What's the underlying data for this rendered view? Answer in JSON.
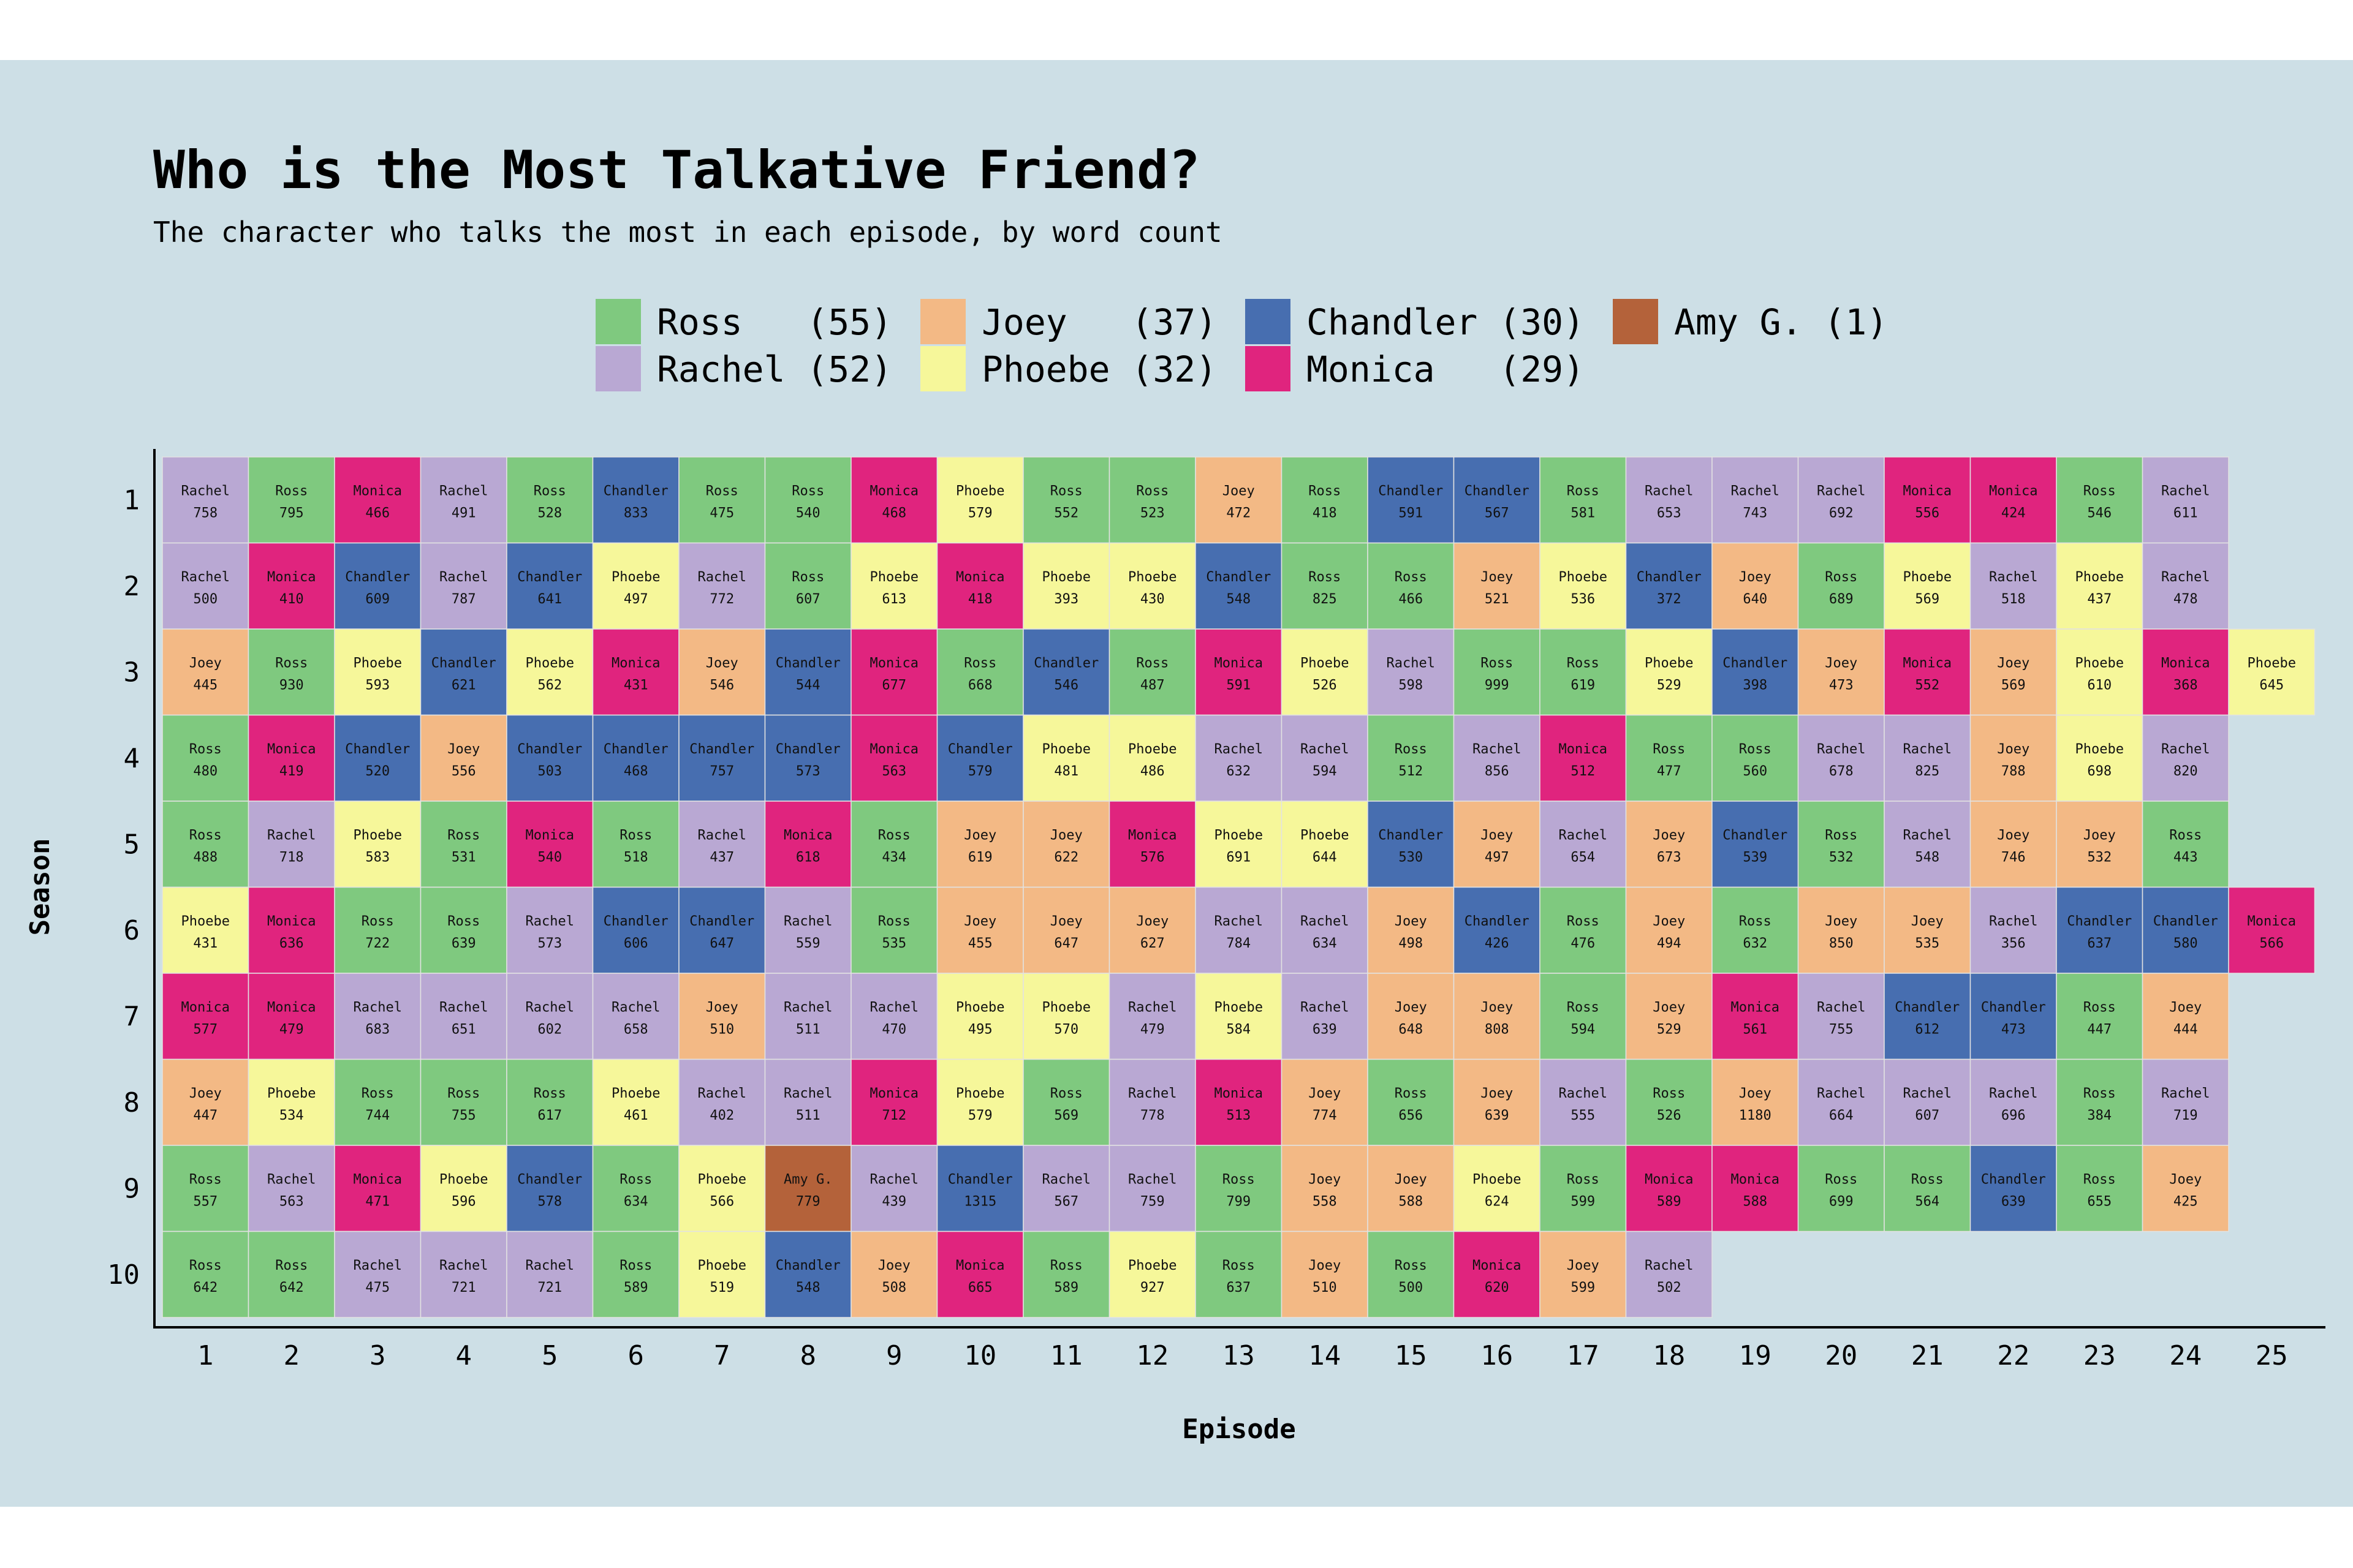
{
  "title": "Who is the Most Talkative Friend?",
  "subtitle": "The character who talks the most in each episode, by word count",
  "chart_data": {
    "type": "heatmap",
    "xlabel": "Episode",
    "ylabel": "Season",
    "x_ticks": [
      1,
      2,
      3,
      4,
      5,
      6,
      7,
      8,
      9,
      10,
      11,
      12,
      13,
      14,
      15,
      16,
      17,
      18,
      19,
      20,
      21,
      22,
      23,
      24,
      25
    ],
    "y_ticks": [
      1,
      2,
      3,
      4,
      5,
      6,
      7,
      8,
      9,
      10
    ],
    "legend": [
      {
        "name": "Ross",
        "count": "(55)",
        "color": "#7fc97f"
      },
      {
        "name": "Joey",
        "count": "(37)",
        "color": "#f3b985"
      },
      {
        "name": "Chandler",
        "count": "(30)",
        "color": "#476eb0"
      },
      {
        "name": "Amy G.",
        "count": "(1)",
        "color": "#b4623a"
      },
      {
        "name": "Rachel",
        "count": "(52)",
        "color": "#b9a8d3"
      },
      {
        "name": "Phoebe",
        "count": "(32)",
        "color": "#f6f79a"
      },
      {
        "name": "Monica",
        "count": "(29)",
        "color": "#e0247e"
      }
    ],
    "colors": {
      "Ross": "#7fc97f",
      "Rachel": "#b9a8d3",
      "Joey": "#f3b985",
      "Phoebe": "#f6f79a",
      "Chandler": "#476eb0",
      "Monica": "#e0247e",
      "Amy G.": "#b4623a"
    },
    "seasons": [
      [
        [
          "Rachel",
          758
        ],
        [
          "Ross",
          795
        ],
        [
          "Monica",
          466
        ],
        [
          "Rachel",
          491
        ],
        [
          "Ross",
          528
        ],
        [
          "Chandler",
          833
        ],
        [
          "Ross",
          475
        ],
        [
          "Ross",
          540
        ],
        [
          "Monica",
          468
        ],
        [
          "Phoebe",
          579
        ],
        [
          "Ross",
          552
        ],
        [
          "Ross",
          523
        ],
        [
          "Joey",
          472
        ],
        [
          "Ross",
          418
        ],
        [
          "Chandler",
          591
        ],
        [
          "Chandler",
          567
        ],
        [
          "Ross",
          581
        ],
        [
          "Rachel",
          653
        ],
        [
          "Rachel",
          743
        ],
        [
          "Rachel",
          692
        ],
        [
          "Monica",
          556
        ],
        [
          "Monica",
          424
        ],
        [
          "Ross",
          546
        ],
        [
          "Rachel",
          611
        ]
      ],
      [
        [
          "Rachel",
          500
        ],
        [
          "Monica",
          410
        ],
        [
          "Chandler",
          609
        ],
        [
          "Rachel",
          787
        ],
        [
          "Chandler",
          641
        ],
        [
          "Phoebe",
          497
        ],
        [
          "Rachel",
          772
        ],
        [
          "Ross",
          607
        ],
        [
          "Phoebe",
          613
        ],
        [
          "Monica",
          418
        ],
        [
          "Phoebe",
          393
        ],
        [
          "Phoebe",
          430
        ],
        [
          "Chandler",
          548
        ],
        [
          "Ross",
          825
        ],
        [
          "Ross",
          466
        ],
        [
          "Joey",
          521
        ],
        [
          "Phoebe",
          536
        ],
        [
          "Chandler",
          372
        ],
        [
          "Joey",
          640
        ],
        [
          "Ross",
          689
        ],
        [
          "Phoebe",
          569
        ],
        [
          "Rachel",
          518
        ],
        [
          "Phoebe",
          437
        ],
        [
          "Rachel",
          478
        ]
      ],
      [
        [
          "Joey",
          445
        ],
        [
          "Ross",
          930
        ],
        [
          "Phoebe",
          593
        ],
        [
          "Chandler",
          621
        ],
        [
          "Phoebe",
          562
        ],
        [
          "Monica",
          431
        ],
        [
          "Joey",
          546
        ],
        [
          "Chandler",
          544
        ],
        [
          "Monica",
          677
        ],
        [
          "Ross",
          668
        ],
        [
          "Chandler",
          546
        ],
        [
          "Ross",
          487
        ],
        [
          "Monica",
          591
        ],
        [
          "Phoebe",
          526
        ],
        [
          "Rachel",
          598
        ],
        [
          "Ross",
          999
        ],
        [
          "Ross",
          619
        ],
        [
          "Phoebe",
          529
        ],
        [
          "Chandler",
          398
        ],
        [
          "Joey",
          473
        ],
        [
          "Monica",
          552
        ],
        [
          "Joey",
          569
        ],
        [
          "Phoebe",
          610
        ],
        [
          "Monica",
          368
        ],
        [
          "Phoebe",
          645
        ]
      ],
      [
        [
          "Ross",
          480
        ],
        [
          "Monica",
          419
        ],
        [
          "Chandler",
          520
        ],
        [
          "Joey",
          556
        ],
        [
          "Chandler",
          503
        ],
        [
          "Chandler",
          468
        ],
        [
          "Chandler",
          757
        ],
        [
          "Chandler",
          573
        ],
        [
          "Monica",
          563
        ],
        [
          "Chandler",
          579
        ],
        [
          "Phoebe",
          481
        ],
        [
          "Phoebe",
          486
        ],
        [
          "Rachel",
          632
        ],
        [
          "Rachel",
          594
        ],
        [
          "Ross",
          512
        ],
        [
          "Rachel",
          856
        ],
        [
          "Monica",
          512
        ],
        [
          "Ross",
          477
        ],
        [
          "Ross",
          560
        ],
        [
          "Rachel",
          678
        ],
        [
          "Rachel",
          825
        ],
        [
          "Joey",
          788
        ],
        [
          "Phoebe",
          698
        ],
        [
          "Rachel",
          820
        ]
      ],
      [
        [
          "Ross",
          488
        ],
        [
          "Rachel",
          718
        ],
        [
          "Phoebe",
          583
        ],
        [
          "Ross",
          531
        ],
        [
          "Monica",
          540
        ],
        [
          "Ross",
          518
        ],
        [
          "Rachel",
          437
        ],
        [
          "Monica",
          618
        ],
        [
          "Ross",
          434
        ],
        [
          "Joey",
          619
        ],
        [
          "Joey",
          622
        ],
        [
          "Monica",
          576
        ],
        [
          "Phoebe",
          691
        ],
        [
          "Phoebe",
          644
        ],
        [
          "Chandler",
          530
        ],
        [
          "Joey",
          497
        ],
        [
          "Rachel",
          654
        ],
        [
          "Joey",
          673
        ],
        [
          "Chandler",
          539
        ],
        [
          "Ross",
          532
        ],
        [
          "Rachel",
          548
        ],
        [
          "Joey",
          746
        ],
        [
          "Joey",
          532
        ],
        [
          "Ross",
          443
        ]
      ],
      [
        [
          "Phoebe",
          431
        ],
        [
          "Monica",
          636
        ],
        [
          "Ross",
          722
        ],
        [
          "Ross",
          639
        ],
        [
          "Rachel",
          573
        ],
        [
          "Chandler",
          606
        ],
        [
          "Chandler",
          647
        ],
        [
          "Rachel",
          559
        ],
        [
          "Ross",
          535
        ],
        [
          "Joey",
          455
        ],
        [
          "Joey",
          647
        ],
        [
          "Joey",
          627
        ],
        [
          "Rachel",
          784
        ],
        [
          "Rachel",
          634
        ],
        [
          "Joey",
          498
        ],
        [
          "Chandler",
          426
        ],
        [
          "Ross",
          476
        ],
        [
          "Joey",
          494
        ],
        [
          "Ross",
          632
        ],
        [
          "Joey",
          850
        ],
        [
          "Joey",
          535
        ],
        [
          "Rachel",
          356
        ],
        [
          "Chandler",
          637
        ],
        [
          "Chandler",
          580
        ],
        [
          "Monica",
          566
        ]
      ],
      [
        [
          "Monica",
          577
        ],
        [
          "Monica",
          479
        ],
        [
          "Rachel",
          683
        ],
        [
          "Rachel",
          651
        ],
        [
          "Rachel",
          602
        ],
        [
          "Rachel",
          658
        ],
        [
          "Joey",
          510
        ],
        [
          "Rachel",
          511
        ],
        [
          "Rachel",
          470
        ],
        [
          "Phoebe",
          495
        ],
        [
          "Phoebe",
          570
        ],
        [
          "Rachel",
          479
        ],
        [
          "Phoebe",
          584
        ],
        [
          "Rachel",
          639
        ],
        [
          "Joey",
          648
        ],
        [
          "Joey",
          808
        ],
        [
          "Ross",
          594
        ],
        [
          "Joey",
          529
        ],
        [
          "Monica",
          561
        ],
        [
          "Rachel",
          755
        ],
        [
          "Chandler",
          612
        ],
        [
          "Chandler",
          473
        ],
        [
          "Ross",
          447
        ],
        [
          "Joey",
          444
        ]
      ],
      [
        [
          "Joey",
          447
        ],
        [
          "Phoebe",
          534
        ],
        [
          "Ross",
          744
        ],
        [
          "Ross",
          755
        ],
        [
          "Ross",
          617
        ],
        [
          "Phoebe",
          461
        ],
        [
          "Rachel",
          402
        ],
        [
          "Rachel",
          511
        ],
        [
          "Monica",
          712
        ],
        [
          "Phoebe",
          579
        ],
        [
          "Ross",
          569
        ],
        [
          "Rachel",
          778
        ],
        [
          "Monica",
          513
        ],
        [
          "Joey",
          774
        ],
        [
          "Ross",
          656
        ],
        [
          "Joey",
          639
        ],
        [
          "Rachel",
          555
        ],
        [
          "Ross",
          526
        ],
        [
          "Joey",
          1180
        ],
        [
          "Rachel",
          664
        ],
        [
          "Rachel",
          607
        ],
        [
          "Rachel",
          696
        ],
        [
          "Ross",
          384
        ],
        [
          "Rachel",
          719
        ]
      ],
      [
        [
          "Ross",
          557
        ],
        [
          "Rachel",
          563
        ],
        [
          "Monica",
          471
        ],
        [
          "Phoebe",
          596
        ],
        [
          "Chandler",
          578
        ],
        [
          "Ross",
          634
        ],
        [
          "Phoebe",
          566
        ],
        [
          "Amy G.",
          779
        ],
        [
          "Rachel",
          439
        ],
        [
          "Chandler",
          1315
        ],
        [
          "Rachel",
          567
        ],
        [
          "Rachel",
          759
        ],
        [
          "Ross",
          799
        ],
        [
          "Joey",
          558
        ],
        [
          "Joey",
          588
        ],
        [
          "Phoebe",
          624
        ],
        [
          "Ross",
          599
        ],
        [
          "Monica",
          589
        ],
        [
          "Monica",
          588
        ],
        [
          "Ross",
          699
        ],
        [
          "Ross",
          564
        ],
        [
          "Chandler",
          639
        ],
        [
          "Ross",
          655
        ],
        [
          "Joey",
          425
        ]
      ],
      [
        [
          "Ross",
          642
        ],
        [
          "Ross",
          642
        ],
        [
          "Rachel",
          475
        ],
        [
          "Rachel",
          721
        ],
        [
          "Rachel",
          721
        ],
        [
          "Ross",
          589
        ],
        [
          "Phoebe",
          519
        ],
        [
          "Chandler",
          548
        ],
        [
          "Joey",
          508
        ],
        [
          "Monica",
          665
        ],
        [
          "Ross",
          589
        ],
        [
          "Phoebe",
          927
        ],
        [
          "Ross",
          637
        ],
        [
          "Joey",
          510
        ],
        [
          "Ross",
          500
        ],
        [
          "Monica",
          620
        ],
        [
          "Joey",
          599
        ],
        [
          "Rachel",
          502
        ]
      ]
    ]
  }
}
